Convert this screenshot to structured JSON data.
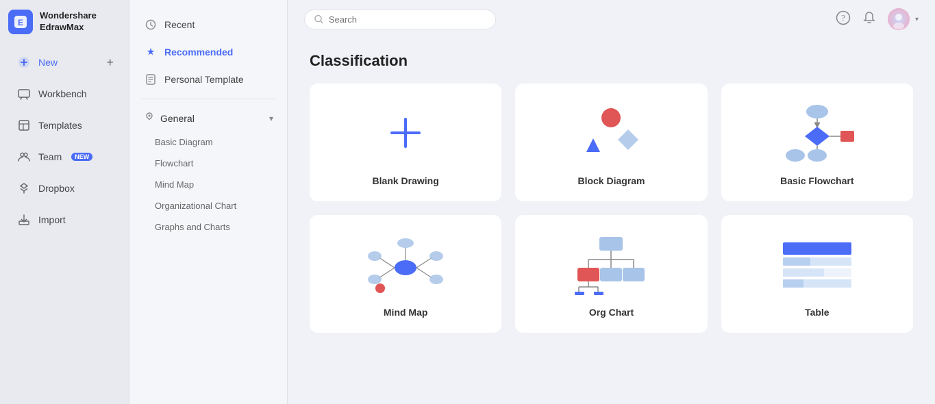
{
  "app": {
    "logo_line1": "Wondershare",
    "logo_line2": "EdrawMax",
    "logo_letter": "E"
  },
  "sidebar": {
    "items": [
      {
        "id": "new",
        "label": "New",
        "icon": "➕",
        "badge": null,
        "active": false
      },
      {
        "id": "workbench",
        "label": "Workbench",
        "icon": "🖥",
        "badge": null,
        "active": false
      },
      {
        "id": "templates",
        "label": "Templates",
        "icon": "📋",
        "badge": null,
        "active": false
      },
      {
        "id": "team",
        "label": "Team",
        "icon": "👥",
        "badge": "NEW",
        "active": false
      },
      {
        "id": "dropbox",
        "label": "Dropbox",
        "icon": "📦",
        "badge": null,
        "active": false
      },
      {
        "id": "import",
        "label": "Import",
        "icon": "📥",
        "badge": null,
        "active": false
      }
    ]
  },
  "middle_panel": {
    "items": [
      {
        "id": "recent",
        "label": "Recent",
        "icon": "🕐",
        "active": false
      },
      {
        "id": "recommended",
        "label": "Recommended",
        "icon": "⭐",
        "active": true
      },
      {
        "id": "personal",
        "label": "Personal Template",
        "icon": "🗒",
        "active": false
      }
    ],
    "sections": [
      {
        "id": "general",
        "label": "General",
        "expanded": true,
        "sub_items": [
          "Basic Diagram",
          "Flowchart",
          "Mind Map",
          "Organizational Chart",
          "Graphs and Charts"
        ]
      }
    ]
  },
  "topbar": {
    "search_placeholder": "Search"
  },
  "main": {
    "section_title": "Classification",
    "cards": [
      {
        "id": "blank",
        "label": "Blank Drawing",
        "type": "blank"
      },
      {
        "id": "block",
        "label": "Block Diagram",
        "type": "block"
      },
      {
        "id": "flowchart",
        "label": "Basic Flowchart",
        "type": "flowchart"
      },
      {
        "id": "mindmap",
        "label": "Mind Map",
        "type": "mindmap"
      },
      {
        "id": "orgchart",
        "label": "Org Chart",
        "type": "orgchart"
      },
      {
        "id": "table",
        "label": "Table",
        "type": "table"
      }
    ]
  }
}
